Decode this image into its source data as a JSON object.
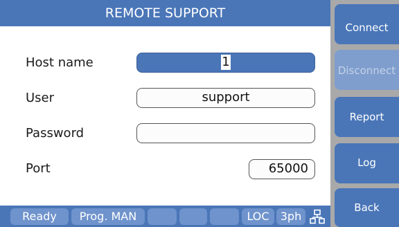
{
  "title": "REMOTE SUPPORT",
  "fields": {
    "host": {
      "label": "Host name",
      "value": "1"
    },
    "user": {
      "label": "User",
      "value": "support"
    },
    "password": {
      "label": "Password",
      "value": ""
    },
    "port": {
      "label": "Port",
      "value": "65000"
    }
  },
  "sidebar": {
    "connect": "Connect",
    "disconnect": "Disconnect",
    "report": "Report",
    "log": "Log",
    "back": "Back"
  },
  "status": {
    "ready": "Ready",
    "prog": "Prog. MAN",
    "loc": "LOC",
    "phase": "3ph",
    "network_icon": "network-icon"
  },
  "colors": {
    "accent": "#4a76b8",
    "disabled": "#7f9ecd",
    "background": "#a9a9a9"
  }
}
